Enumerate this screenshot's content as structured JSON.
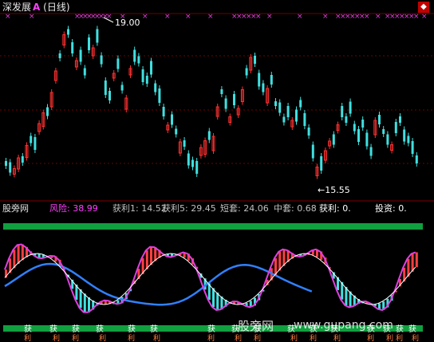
{
  "header": {
    "stock_name": "深发展",
    "stock_mark": "A",
    "period": "(日线)"
  },
  "price_annotations": {
    "high_label": "19.00",
    "low_label": "←15.55"
  },
  "indicator": {
    "name": "股旁网",
    "items": [
      {
        "label": "风险:",
        "value": "38.99",
        "color": "#ff40ff"
      },
      {
        "label": "获利1:",
        "value": "14.52",
        "color": "#c0c0c0"
      },
      {
        "label": "获利5:",
        "value": "29.45",
        "color": "#c0c0c0"
      },
      {
        "label": "短套:",
        "value": "24.06",
        "color": "#c0c0c0"
      },
      {
        "label": "中套:",
        "value": "0.68",
        "color": "#c0c0c0"
      },
      {
        "label": "获利:",
        "value": "0.",
        "color": "#ffffff"
      },
      {
        "label": "投资:",
        "value": "0.",
        "color": "#ffffff"
      }
    ]
  },
  "signals": {
    "buy_label": "获",
    "sell_label": "利"
  },
  "watermark": {
    "cn": "股旁网",
    "url": "www.gupang.com"
  },
  "colors": {
    "up": "#ff3030",
    "down": "#40e0e0",
    "magenta": "#e040e0",
    "blue": "#3060ff",
    "green": "#10a040",
    "white": "#ffffff"
  }
}
